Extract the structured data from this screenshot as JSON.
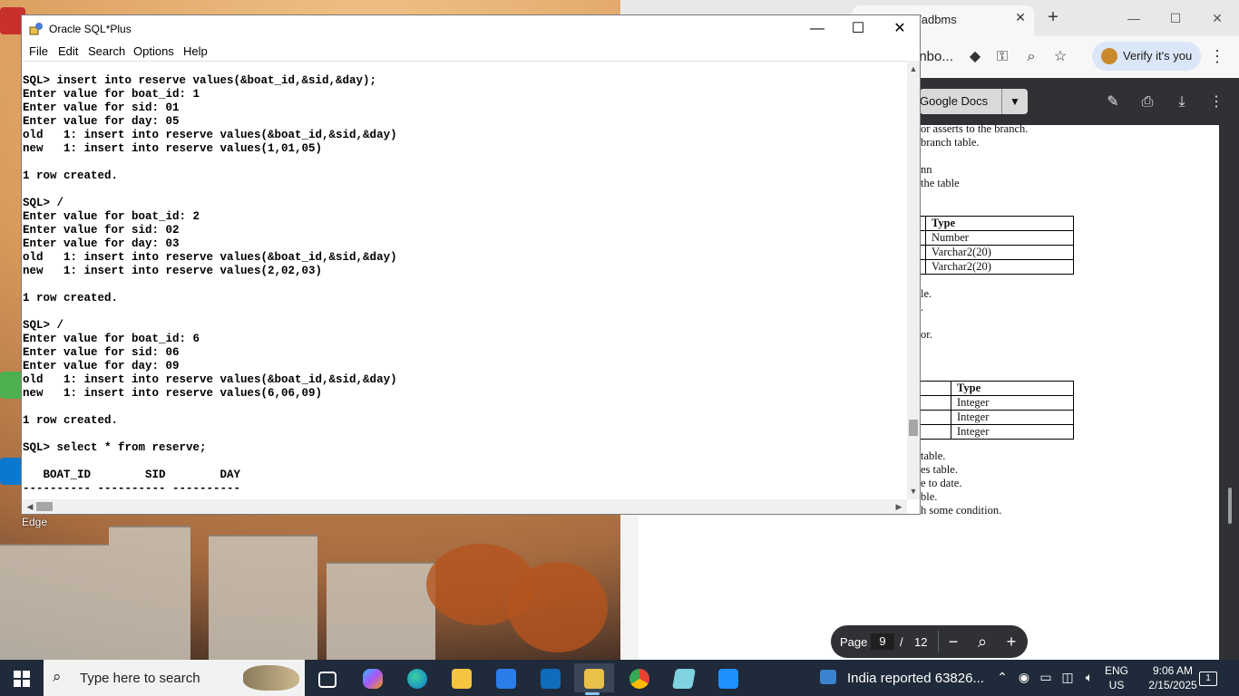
{
  "sqlplus": {
    "title": "Oracle SQL*Plus",
    "menu": [
      "File",
      "Edit",
      "Search",
      "Options",
      "Help"
    ],
    "console_lines": [
      "SQL> insert into reserve values(&boat_id,&sid,&day);",
      "Enter value for boat_id: 1",
      "Enter value for sid: 01",
      "Enter value for day: 05",
      "old   1: insert into reserve values(&boat_id,&sid,&day)",
      "new   1: insert into reserve values(1,01,05)",
      "",
      "1 row created.",
      "",
      "SQL> /",
      "Enter value for boat_id: 2",
      "Enter value for sid: 02",
      "Enter value for day: 03",
      "old   1: insert into reserve values(&boat_id,&sid,&day)",
      "new   1: insert into reserve values(2,02,03)",
      "",
      "1 row created.",
      "",
      "SQL> /",
      "Enter value for boat_id: 6",
      "Enter value for sid: 06",
      "Enter value for day: 09",
      "old   1: insert into reserve values(&boat_id,&sid,&day)",
      "new   1: insert into reserve values(6,06,09)",
      "",
      "1 row created.",
      "",
      "SQL> select * from reserve;",
      "",
      "   BOAT_ID        SID        DAY",
      "---------- ---------- ----------"
    ]
  },
  "browser": {
    "tab_title": "in/adbms",
    "address_fragment": "inbo...",
    "verify_label": "Verify it's you",
    "gdocs_label": "Google Docs",
    "pdf_lines_1": [
      "or asserts to the branch.",
      "branch table."
    ],
    "pdf_lines_2": [
      "nn",
      "the table"
    ],
    "table1": {
      "header": "Type",
      "rows": [
        "Number",
        "Varchar2(20)",
        "Varchar2(20)"
      ]
    },
    "pdf_lines_3": [
      "le.",
      "."
    ],
    "pdf_lines_4": [
      "or."
    ],
    "table2": {
      "header": "Type",
      "rows": [
        "Integer",
        "Integer",
        "Integer"
      ]
    },
    "pdf_lines_5": [
      "table.",
      "es table.",
      "e to date.",
      "ble.",
      "h some condition."
    ],
    "page_label": "Page",
    "page_current": "9",
    "page_sep": "/",
    "page_total": "12"
  },
  "desktop": {
    "edge_label": "Edge"
  },
  "taskbar": {
    "search_placeholder": "Type here to search",
    "news_text": "India reported 63826...",
    "lang_top": "ENG",
    "lang_bottom": "US",
    "time": "9:06 AM",
    "date": "2/15/2025",
    "notif_count": "1"
  },
  "colors": {
    "taskbar": "#1f2a3a",
    "pdf_toolbar": "#303134",
    "verify_bg": "#dce6f9"
  }
}
